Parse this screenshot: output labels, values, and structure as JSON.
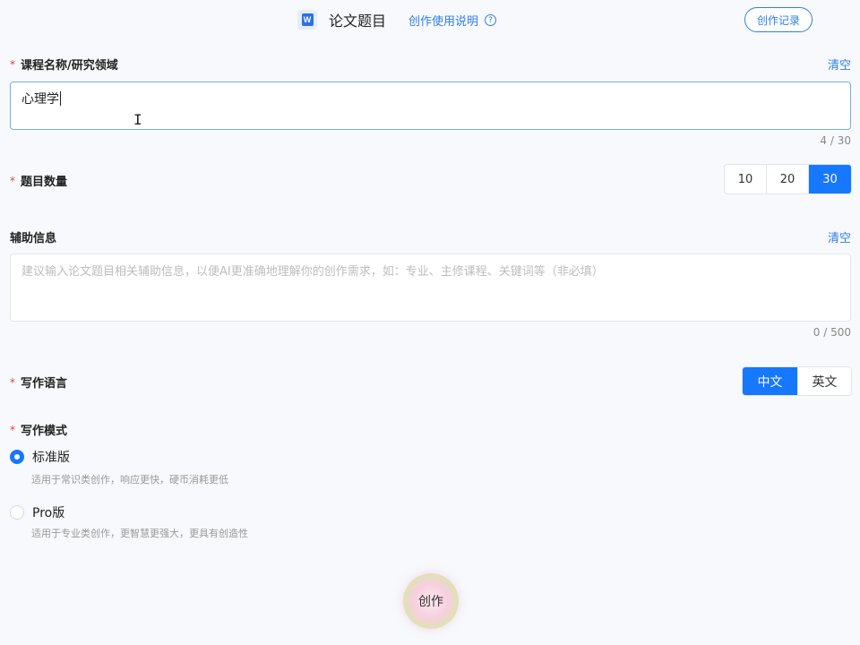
{
  "header": {
    "title": "论文题目",
    "word_icon_letter": "W",
    "help_link": "创作使用说明",
    "help_icon_glyph": "?",
    "history_button": "创作记录"
  },
  "course": {
    "label": "课程名称/研究领域",
    "required_mark": "*",
    "clear": "清空",
    "value": "心理学",
    "counter": "4 / 30"
  },
  "count": {
    "label": "题目数量",
    "options": [
      "10",
      "20",
      "30"
    ],
    "selected": "30"
  },
  "aux": {
    "label": "辅助信息",
    "clear": "清空",
    "placeholder": "建议输入论文题目相关辅助信息，以便AI更准确地理解你的创作需求，如：专业、主修课程、关键词等（非必填）",
    "counter": "0 / 500"
  },
  "language": {
    "label": "写作语言",
    "options": [
      "中文",
      "英文"
    ],
    "selected": "中文"
  },
  "mode": {
    "label": "写作模式",
    "options": [
      {
        "label": "标准版",
        "desc": "适用于常识类创作，响应更快，硬币消耗更低",
        "checked": true
      },
      {
        "label": "Pro版",
        "desc": "适用于专业类创作，更智慧更强大，更具有创造性",
        "checked": false
      }
    ]
  },
  "create_button": "创作",
  "colors": {
    "accent": "#1677ff",
    "link": "#2f7fe8",
    "required": "#e8413b"
  },
  "icons": {
    "word": "word-doc-icon",
    "help": "question-circle-icon",
    "cursor": "text-cursor-icon"
  }
}
